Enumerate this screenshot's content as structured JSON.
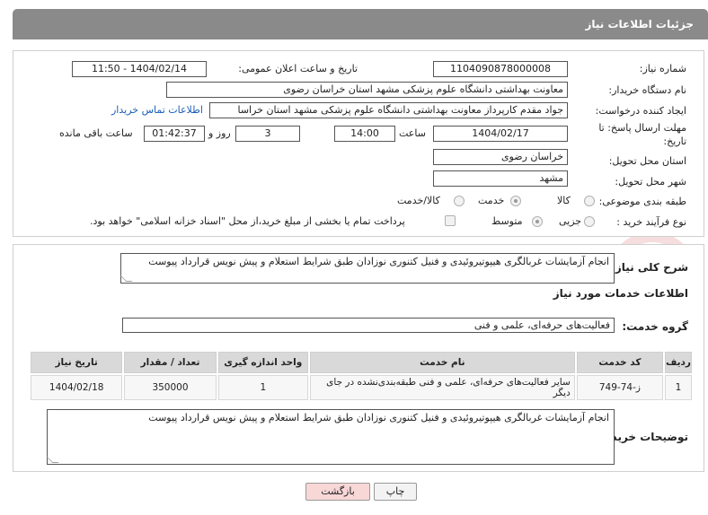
{
  "title": "جزئیات اطلاعات نیاز",
  "fields": {
    "need_number_label": "شماره نیاز:",
    "need_number": "1104090878000008",
    "announce_label": "تاریخ و ساعت اعلان عمومی:",
    "announce_value": "1404/02/14 - 11:50",
    "buyer_org_label": "نام دستگاه خریدار:",
    "buyer_org": "معاونت بهداشتی دانشگاه علوم پزشکی مشهد استان خراسان رضوی",
    "creator_label": "ایجاد کننده درخواست:",
    "creator": "جواد مقدم کارپرداز معاونت بهداشتی دانشگاه علوم پزشکی مشهد استان خراسا",
    "contact_link": "اطلاعات تماس خریدار",
    "deadline_label_1": "مهلت ارسال پاسخ: تا",
    "deadline_label_2": "تاریخ:",
    "deadline_date": "1404/02/17",
    "time_label": "ساعت",
    "deadline_time": "14:00",
    "days_value": "3",
    "days_label": "روز و",
    "remaining_time": "01:42:37",
    "remaining_label": "ساعت باقی مانده",
    "province_label": "استان محل تحویل:",
    "province": "خراسان رضوی",
    "city_label": "شهر محل تحویل:",
    "city": "مشهد",
    "category_label": "طبقه بندی موضوعی:",
    "category_options": [
      "کالا",
      "خدمت",
      "کالا/خدمت"
    ],
    "process_label": "نوع فرآیند خرید :",
    "process_options": [
      "جزیی",
      "متوسط"
    ],
    "treasury_note": "پرداخت تمام یا بخشی از مبلغ خرید،از محل \"اسناد خزانه اسلامی\" خواهد بود."
  },
  "details": {
    "summary_label": "شرح کلی نیاز:",
    "summary_text": "انجام آزمایشات غربالگری هیپوتیروئیدی و فنیل کتنوری نوزادان طبق شرایط استعلام و پیش نویس قرارداد پیوست",
    "services_heading": "اطلاعات خدمات مورد نیاز",
    "service_group_label": "گروه خدمت:",
    "service_group": "فعالیت‌های حرفه‌ای، علمی و فنی",
    "table": {
      "headers": [
        "ردیف",
        "کد خدمت",
        "نام خدمت",
        "واحد اندازه گیری",
        "تعداد / مقدار",
        "تاریخ نیاز"
      ],
      "rows": [
        [
          "1",
          "ز-74-749",
          "سایر فعالیت‌های حرفه‌ای، علمی و فنی طبقه‌بندی‌نشده در جای دیگر",
          "1",
          "350000",
          "1404/02/18"
        ]
      ]
    },
    "buyer_notes_label": "توضیحات خریدار:",
    "buyer_notes": "انجام آزمایشات غربالگری هیپوتیروئیدی و فنیل کتنوری نوزادان طبق شرایط استعلام و پیش نویس قرارداد پیوست"
  },
  "buttons": {
    "print": "چاپ",
    "back": "بازگشت"
  },
  "watermark_text": "AriaTender.neT",
  "colors": {
    "title_bg": "#8a8a8a",
    "link": "#1a5fb4",
    "back_bg": "#f8d7d7",
    "watermark": "#e6a3a3"
  }
}
